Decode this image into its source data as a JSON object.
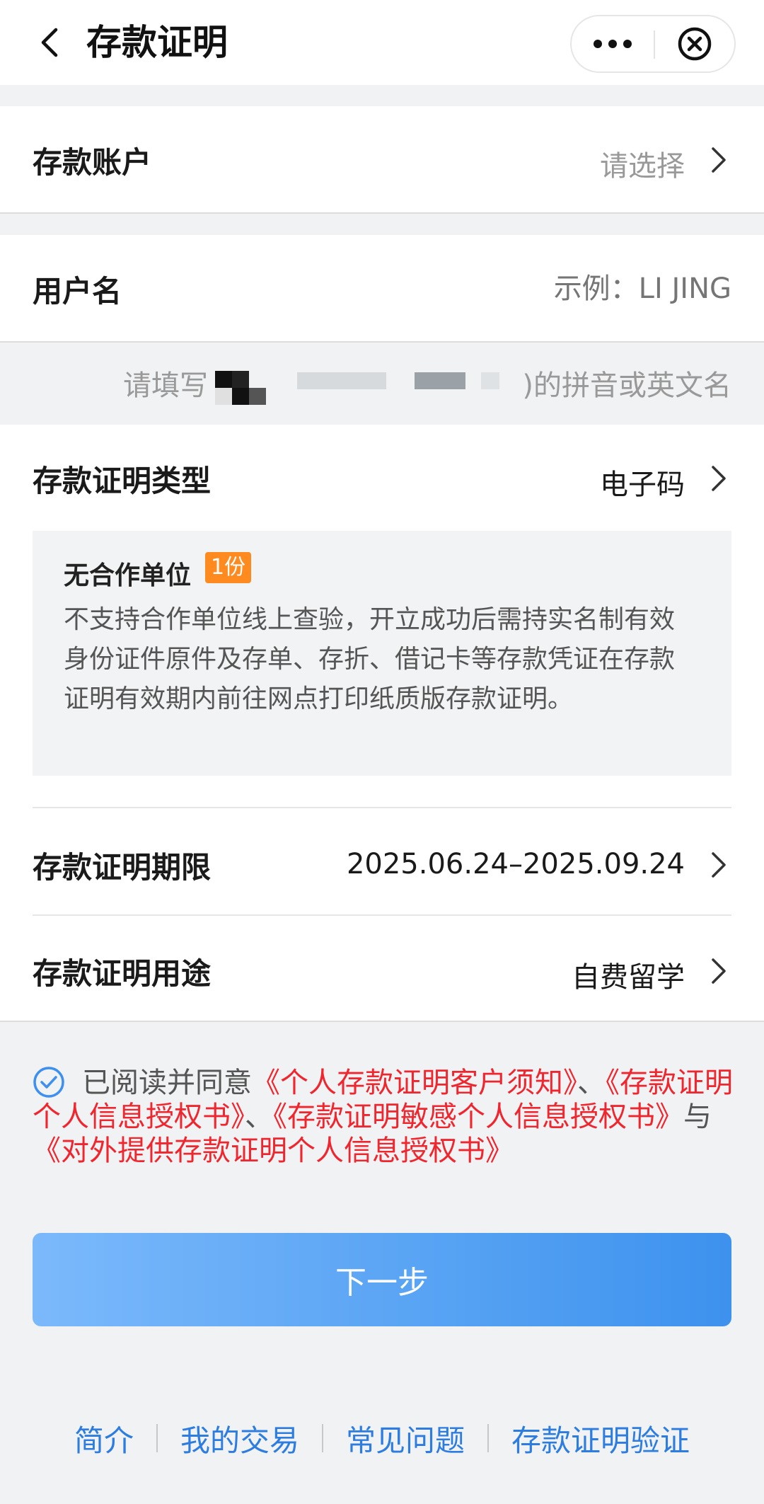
{
  "nav": {
    "title": "存款证明"
  },
  "account": {
    "label": "存款账户",
    "placeholder": "请选择"
  },
  "username": {
    "label": "用户名",
    "placeholder": "示例：LI JING",
    "hint_prefix": "请填写",
    "hint_suffix": ")的拼音或英文名"
  },
  "cert_type": {
    "label": "存款证明类型",
    "value": "电子码",
    "info_title": "无合作单位",
    "badge": "1份",
    "info_desc": "不支持合作单位线上查验，开立成功后需持实名制有效身份证件原件及存单、存折、借记卡等存款凭证在存款证明有效期内前往网点打印纸质版存款证明。"
  },
  "period": {
    "label": "存款证明期限",
    "value": "2025.06.24–2025.09.24"
  },
  "purpose": {
    "label": "存款证明用途",
    "value": "自费留学"
  },
  "agreement": {
    "prefix": "已阅读并同意",
    "link1": "《个人存款证明客户须知》",
    "sep1": "、",
    "link2": "《存款证明个人信息授权书》",
    "sep2": "、",
    "link3": "《存款证明敏感个人信息授权书》",
    "sep3": "与",
    "link4": "《对外提供存款证明个人信息授权书》"
  },
  "next_button": "下一步",
  "footer": {
    "intro": "简介",
    "my_transactions": "我的交易",
    "faq": "常见问题",
    "verify": "存款证明验证"
  },
  "colors": {
    "accent_blue": "#2d7ce0",
    "link_red": "#f0262f",
    "badge_orange": "#ff8a1f",
    "button_gradient_start": "#7bb9fb",
    "button_gradient_end": "#3d92ee"
  }
}
